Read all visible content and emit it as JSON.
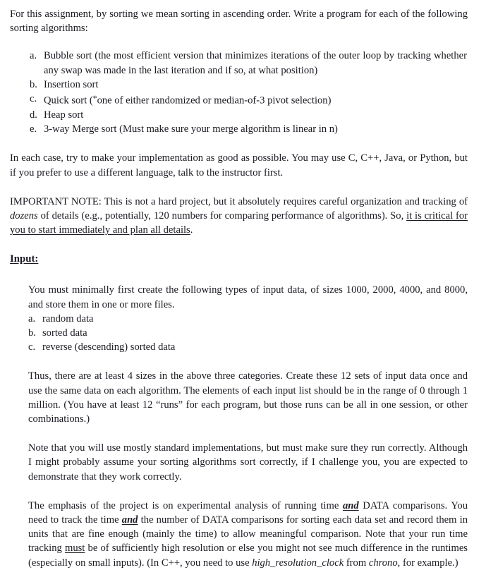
{
  "document": {
    "intro": {
      "text_before": "For this assignment, by sorting we mean sorting in ascending order.  Write a program for each of the following sorting algorithms:"
    },
    "algorithms_list": [
      {
        "marker": "a.",
        "text": "Bubble sort (the most efficient version that minimizes iterations of the outer loop by tracking whether any swap was made in the last iteration and if so, at what position)"
      },
      {
        "marker": "b.",
        "text": "Insertion sort"
      },
      {
        "marker": "c.",
        "text_part1": "Quick sort (",
        "asterisk": "*",
        "text_part2": "one of either randomized or median-of-3 pivot selection)"
      },
      {
        "marker": "d.",
        "text": "Heap sort"
      },
      {
        "marker": "e.",
        "text": "3-way Merge sort (Must make sure your merge algorithm is linear in n)"
      }
    ],
    "languages_para": {
      "text": "In each case, try to make your implementation as good as possible.  You may use C, C++, Java, or Python, but if you prefer to use a different language, talk to the instructor first."
    },
    "important_note": {
      "part1": "IMPORTANT NOTE: This is not a hard project, but it absolutely requires careful organization and tracking of ",
      "italic_word": "dozens",
      "part2": " of details (e.g., potentially, 120 numbers for comparing performance of algorithms).  So, ",
      "underlined_phrase": "it is critical for you to start immediately and plan all details",
      "part3": "."
    },
    "input_heading": "Input:",
    "input_intro": {
      "text": "You must minimally first create the following types of input data, of sizes 1000, 2000, 4000, and 8000, and store them in one or more files."
    },
    "input_data_list": [
      {
        "marker": "a.",
        "text": "random data"
      },
      {
        "marker": "b.",
        "text": "sorted data"
      },
      {
        "marker": "c.",
        "text": "reverse (descending) sorted data"
      }
    ],
    "sizes_para": {
      "text": "Thus, there are at least 4 sizes in the above three categories.  Create these 12 sets of input data once and use the same data on each algorithm. The elements of each input list should be in the range of 0 through 1 million.  (You have at least 12 “runs” for each program, but those runs can be all in one session, or other combinations.)"
    },
    "standard_impl_para": {
      "text": "Note that you will use mostly standard implementations, but must make sure they run correctly.  Although I might probably assume your sorting algorithms sort correctly, if I challenge you, you are expected to demonstrate that they work correctly."
    },
    "emphasis_para": {
      "p1": "The emphasis of the project is on experimental analysis of running time ",
      "and1": "and",
      "p2": " DATA comparisons.  You need to track the time ",
      "and2": "and",
      "p3": " the number of DATA comparisons for sorting each data set and record them in units that are fine enough (mainly the time) to allow meaningful comparison.  Note that your run time tracking ",
      "must": "must",
      "p4": " be of sufficiently high resolution or else you might not see much difference in the runtimes (especially on small inputs).  (In C++, you need to use ",
      "code1": "high_resolution_clock",
      "p5": " from ",
      "code2": "chrono",
      "p6": ", for example.)"
    }
  },
  "style": {
    "background_color": "#ffffff",
    "text_color": "#1a1a22"
  }
}
